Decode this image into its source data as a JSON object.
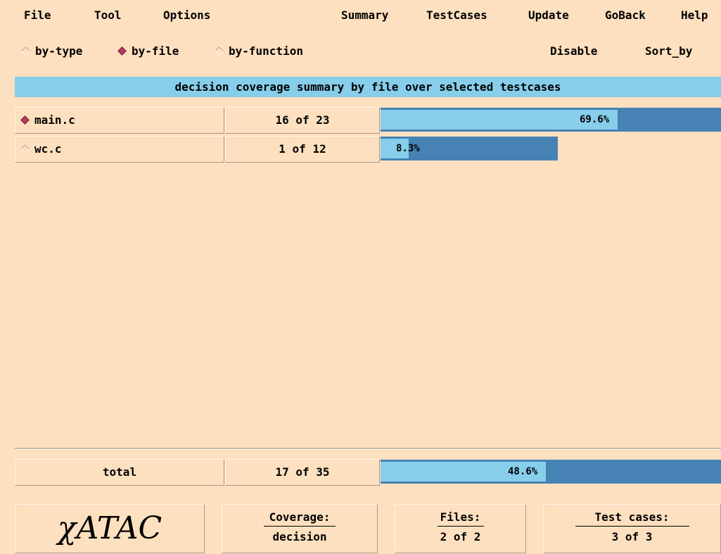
{
  "menu": {
    "file": "File",
    "tool": "Tool",
    "options": "Options",
    "summary": "Summary",
    "testcases": "TestCases",
    "update": "Update",
    "goback": "GoBack",
    "help": "Help"
  },
  "view_options": {
    "by_type": "by-type",
    "by_file": "by-file",
    "by_function": "by-function",
    "selected": "by-file",
    "disable": "Disable",
    "sort_by": "Sort_by"
  },
  "title": "decision coverage summary by file over selected testcases",
  "rows": [
    {
      "name": "main.c",
      "count": "16 of 23",
      "percent": "69.6%",
      "fraction": 0.696,
      "selected": true
    },
    {
      "name": "wc.c",
      "count": "1 of 12",
      "percent": "8.3%",
      "fraction": 0.083,
      "selected": false
    }
  ],
  "total": {
    "label": "total",
    "count": "17 of 35",
    "percent": "48.6%",
    "fraction": 0.486
  },
  "footer": {
    "logo": "χATAC",
    "coverage_label": "Coverage:",
    "coverage_value": "decision",
    "files_label": "Files:",
    "files_value": "2 of 2",
    "testcases_label": "Test cases:",
    "testcases_value": "3 of 3"
  },
  "colors": {
    "background": "#fde0bf",
    "bar_dark": "#4682b4",
    "bar_light": "#87ceeb",
    "selected_diamond": "#b03a5e"
  }
}
